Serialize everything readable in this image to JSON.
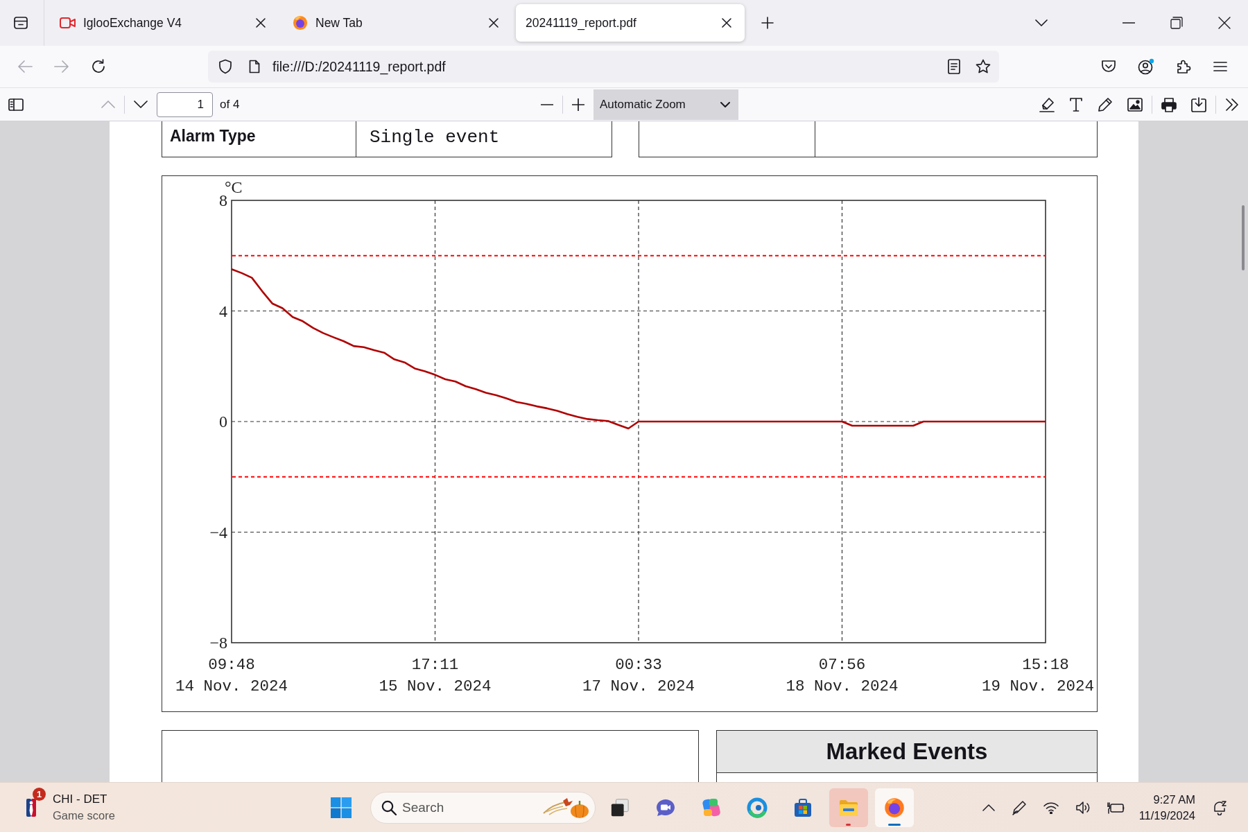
{
  "window": {
    "tabs": [
      {
        "title": "IglooExchange V4",
        "kind": "video",
        "selected": false
      },
      {
        "title": "New Tab",
        "kind": "browser",
        "selected": false
      },
      {
        "title": "20241119_report.pdf",
        "kind": "none",
        "selected": true
      }
    ]
  },
  "navigation": [
    {
      "kind": "back",
      "disabled": true
    },
    {
      "kind": "forward",
      "disabled": true
    },
    {
      "kind": "reload",
      "disabled": false
    }
  ],
  "address_bar": {
    "url": "file:///D:/20241119_report.pdf"
  },
  "pdf_toolbar": {
    "previous_disabled": true,
    "next_disabled": false,
    "page": "1",
    "page_count": "of 4",
    "zoom": "Automatic Zoom"
  },
  "document": {
    "details": [
      {
        "label": "Alarm Type",
        "value": "Single event"
      }
    ],
    "chart": {
      "chart_data": {
        "type": "line",
        "ylabel": "°C",
        "grid": true,
        "categories": [
          "09:48\n14 Nov. 2024",
          null,
          null,
          null,
          null,
          null,
          null,
          null,
          null,
          null,
          null,
          null,
          null,
          null,
          null,
          null,
          null,
          null,
          null,
          null,
          "17:11\n15 Nov. 2024",
          null,
          null,
          null,
          null,
          null,
          null,
          null,
          null,
          null,
          null,
          null,
          null,
          null,
          null,
          null,
          null,
          null,
          null,
          null,
          "00:33\n17 Nov. 2024",
          null,
          null,
          null,
          null,
          null,
          null,
          null,
          null,
          null,
          null,
          null,
          null,
          null,
          null,
          null,
          null,
          null,
          null,
          null,
          "07:56\n18 Nov. 2024",
          null,
          null,
          null,
          null,
          null,
          null,
          null,
          null,
          null,
          null,
          null,
          null,
          null,
          null,
          null,
          null,
          null,
          null,
          null,
          "15:18\n19 Nov. 2024"
        ],
        "series": [
          {
            "color": "#b00000",
            "values": [
              5.51,
              5.37,
              5.2,
              4.72,
              4.27,
              4.1,
              3.78,
              3.63,
              3.39,
              3.2,
              3.05,
              2.91,
              2.73,
              2.69,
              2.58,
              2.49,
              2.25,
              2.14,
              1.92,
              1.82,
              1.69,
              1.53,
              1.45,
              1.28,
              1.17,
              1.04,
              0.95,
              0.84,
              0.71,
              0.64,
              0.55,
              0.48,
              0.39,
              0.27,
              0.17,
              0.09,
              0.05,
              0.02,
              -0.12,
              -0.25,
              0,
              0,
              0,
              0,
              0,
              0,
              0,
              0,
              0,
              0,
              0,
              0,
              0,
              0,
              0,
              0,
              0,
              0,
              0,
              0,
              0,
              -0.15,
              -0.15,
              -0.15,
              -0.15,
              -0.15,
              -0.15,
              -0.15,
              0,
              0,
              0,
              0,
              0,
              0,
              0,
              0,
              0,
              0,
              0,
              0,
              0
            ]
          }
        ],
        "ylim": [
          -8,
          8
        ],
        "yticks": [
          {
            "value": -8,
            "label": "−8"
          },
          {
            "value": -4,
            "label": "−4"
          },
          {
            "value": 0,
            "label": "0"
          },
          {
            "value": 4,
            "label": "4"
          },
          {
            "value": 8,
            "label": "8"
          }
        ],
        "ref_lines": [
          {
            "axis": "y",
            "value": 6,
            "color": "#ff0000"
          },
          {
            "axis": "y",
            "value": -2,
            "color": "#ff0000"
          }
        ]
      }
    },
    "marked_events": {
      "title": "Marked Events"
    }
  },
  "taskbar": {
    "widget": {
      "badge": "1",
      "title": "CHI - DET",
      "subtitle": "Game score"
    },
    "search": {
      "placeholder": "Search"
    },
    "apps": [
      {
        "kind": "taskview",
        "attention": false,
        "active": false
      },
      {
        "kind": "chat",
        "attention": false,
        "active": false
      },
      {
        "kind": "assistant",
        "attention": false,
        "active": false
      },
      {
        "kind": "web",
        "attention": false,
        "active": false
      },
      {
        "kind": "store",
        "attention": false,
        "active": false
      },
      {
        "kind": "files",
        "attention": true,
        "active": false
      },
      {
        "kind": "browser",
        "attention": false,
        "active": true
      }
    ],
    "clock": {
      "time": "9:27 AM",
      "date": "11/19/2024"
    }
  }
}
